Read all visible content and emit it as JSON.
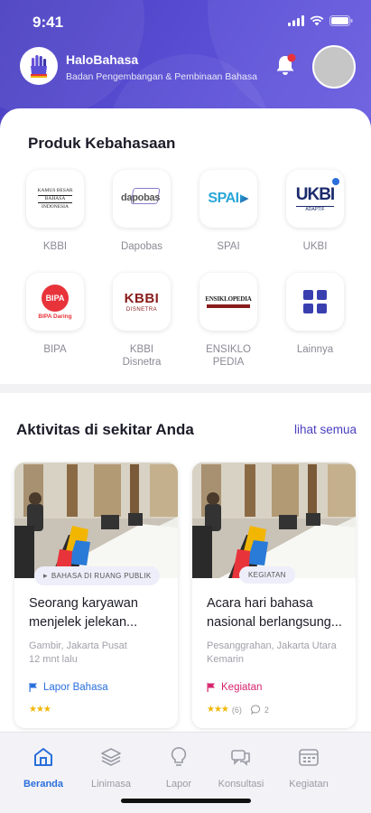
{
  "status_bar": {
    "time": "9:41"
  },
  "header": {
    "app_name": "HaloBahasa",
    "subtitle": "Badan Pengembangan & Pembinaan Bahasa",
    "icons": [
      "hand-logo-icon",
      "bell-icon",
      "avatar"
    ],
    "colors": {
      "header_bg": "#5b4fd6",
      "accent": "#4a3fc0",
      "notification_dot": "#e8333a"
    }
  },
  "products": {
    "title": "Produk Kebahasaan",
    "items": [
      {
        "label": "KBBI",
        "logo_text": [
          "KAMUS BESAR",
          "BAHASA",
          "INDONESIA"
        ]
      },
      {
        "label": "Dapobas",
        "logo_text": "dapobas"
      },
      {
        "label": "SPAI",
        "logo_text": "SPAI"
      },
      {
        "label": "UKBI",
        "logo_text": "UKBI",
        "logo_sub": "ADAPTIF"
      },
      {
        "label": "BIPA",
        "logo_text": "BIPA",
        "logo_sub": "BIPA Daring"
      },
      {
        "label": "KBBI Disnetra",
        "logo_text": "KBBI",
        "logo_sub": "DISNETRA"
      },
      {
        "label": "ENSIKLO PEDIA",
        "logo_text": "ENSIKLOPEDIA"
      },
      {
        "label": "Lainnya",
        "icon": "grid-icon"
      }
    ]
  },
  "activities": {
    "title": "Aktivitas di sekitar Anda",
    "see_all": "lihat semua",
    "cards": [
      {
        "tag": "BAHASA DI RUANG PUBLIK",
        "title_line1": "Seorang karyawan",
        "title_line2": "menjelek jelekan...",
        "location": "Gambir, Jakarta Pusat",
        "time": "12 mnt lalu",
        "category": "Lapor Bahasa",
        "category_color": "#2a6fdb",
        "rating": 3
      },
      {
        "tag": "KEGIATAN",
        "title_line1": "Acara hari bahasa",
        "title_line2": "nasional berlangsung...",
        "location": "Pesanggrahan, Jakarta Utara",
        "time": "Kemarin",
        "category": "Kegiatan",
        "category_color": "#d6246e",
        "rating": 3,
        "rating_count": "(6)",
        "comments": "2"
      }
    ]
  },
  "tabbar": {
    "tabs": [
      {
        "label": "Beranda",
        "icon": "home-icon",
        "active": true
      },
      {
        "label": "Linimasa",
        "icon": "layers-icon",
        "active": false
      },
      {
        "label": "Lapor",
        "icon": "lightbulb-icon",
        "active": false
      },
      {
        "label": "Konsultasi",
        "icon": "chat-icon",
        "active": false
      },
      {
        "label": "Kegiatan",
        "icon": "calendar-icon",
        "active": false
      }
    ]
  }
}
